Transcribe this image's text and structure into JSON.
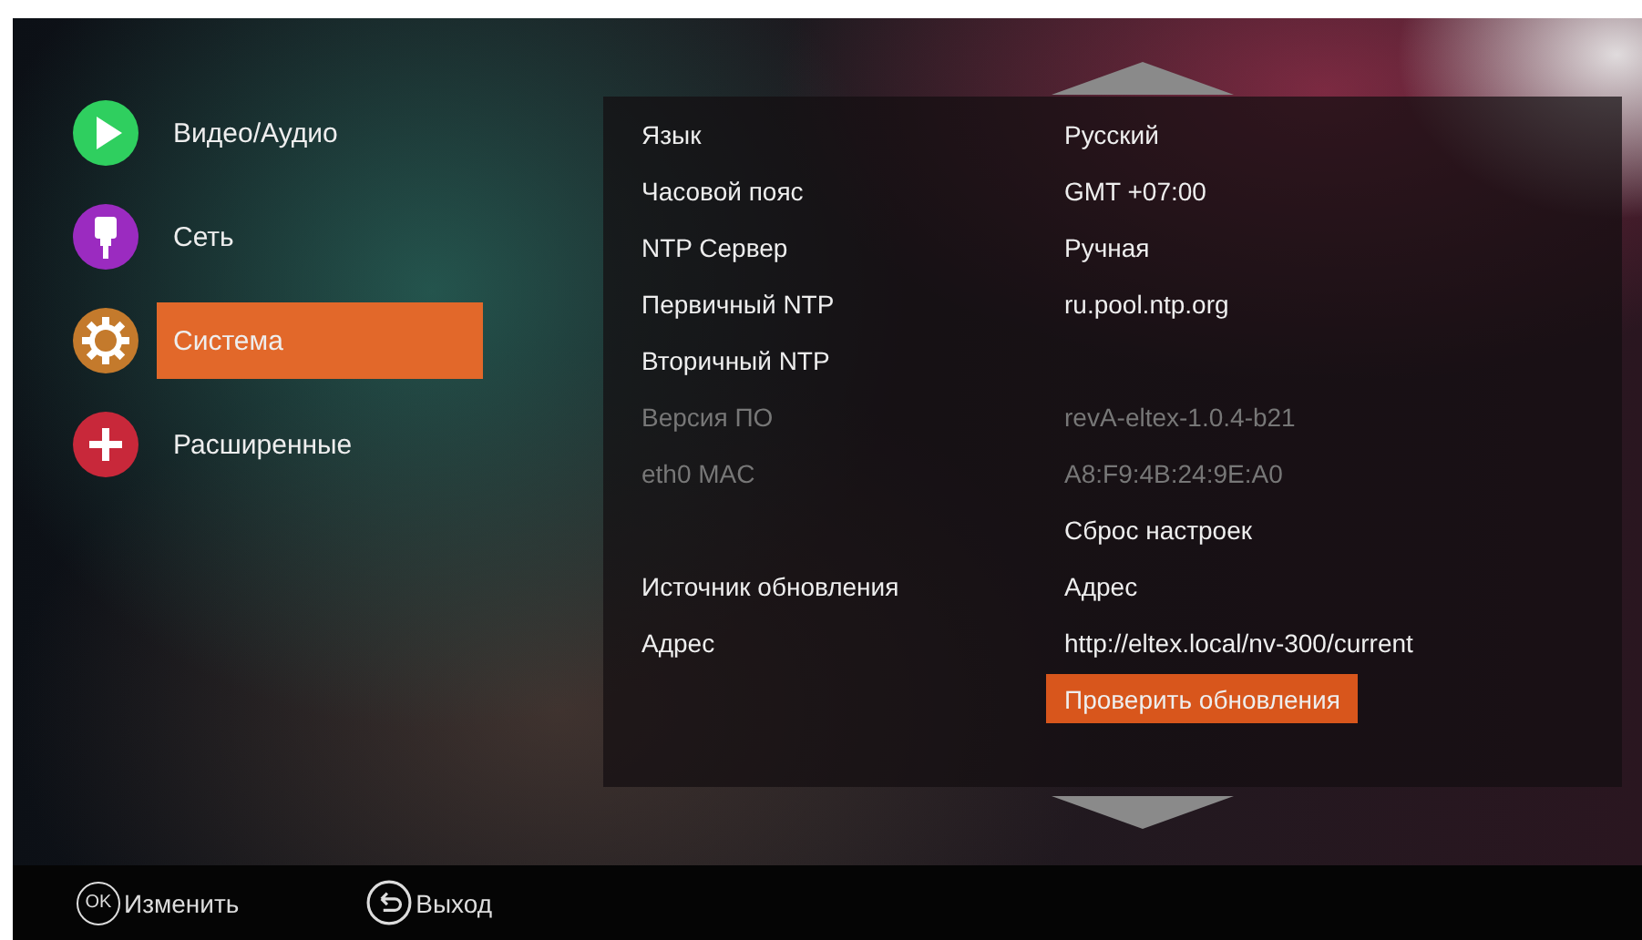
{
  "menu": [
    {
      "label": "Видео/Аудио",
      "kind": "play",
      "color": "#2fcf5f",
      "selected": false
    },
    {
      "label": "Сеть",
      "kind": "network",
      "color": "#9b2bc0",
      "selected": false
    },
    {
      "label": "Система",
      "kind": "gear",
      "color": "#c47a2c",
      "selected": true
    },
    {
      "label": "Расширенные",
      "kind": "plus",
      "color": "#c8283a",
      "selected": false
    }
  ],
  "settings": [
    {
      "kind": "setting",
      "label": "Язык",
      "value": "Русский",
      "disabled": false
    },
    {
      "kind": "setting",
      "label": "Часовой пояс",
      "value": "GMT +07:00",
      "disabled": false
    },
    {
      "kind": "setting",
      "label": "NTP Сервер",
      "value": "Ручная",
      "disabled": false
    },
    {
      "kind": "setting",
      "label": "Первичный NTP",
      "value": "ru.pool.ntp.org",
      "disabled": false
    },
    {
      "kind": "setting",
      "label": "Вторичный NTP",
      "disabled": false
    },
    {
      "kind": "setting",
      "label": "Версия ПО",
      "value": "revA-eltex-1.0.4-b21",
      "disabled": true
    },
    {
      "kind": "setting",
      "label": "eth0 MAC",
      "value": "A8:F9:4B:24:9E:A0",
      "disabled": true
    },
    {
      "kind": "action",
      "value": "Сброс настроек",
      "selected": false
    },
    {
      "kind": "setting",
      "label": "Источник обновления",
      "value": "Адрес",
      "disabled": false
    },
    {
      "kind": "setting",
      "label": "Адрес",
      "value": "http://eltex.local/nv-300/current",
      "disabled": false
    },
    {
      "kind": "action",
      "value": "Проверить обновления",
      "selected": true
    }
  ],
  "footer": [
    {
      "kind": "ok",
      "key": "OK",
      "label": "Изменить"
    },
    {
      "kind": "back",
      "label": "Выход"
    }
  ]
}
